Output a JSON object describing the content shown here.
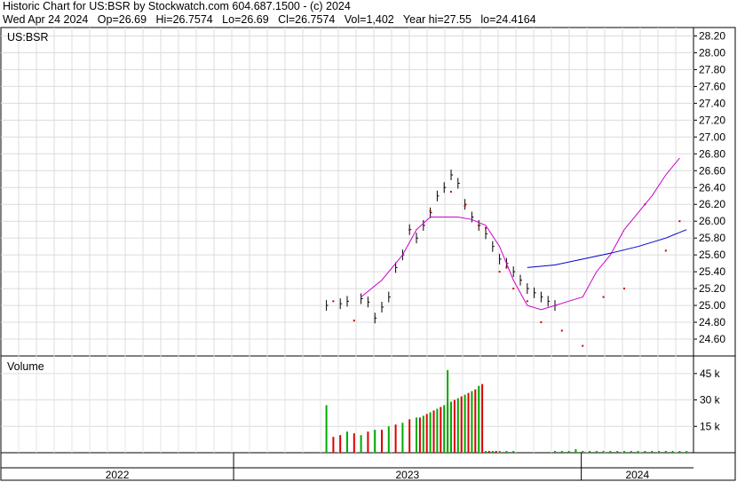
{
  "header": {
    "line1": "Historic Chart for US:BSR by Stockwatch.com 604.687.1500 - (c) 2024",
    "line2": "Wed Apr 24 2024   Op=26.69   Hi=26.7574   Lo=26.69   Cl=26.7574   Vol=1,402   Year hi=27.55   lo=24.4164"
  },
  "chart_data": [
    {
      "type": "line",
      "title": "US:BSR",
      "ylim": [
        24.4,
        28.3
      ],
      "y_ticks": [
        "28.20",
        "28.00",
        "27.80",
        "27.60",
        "27.40",
        "27.20",
        "27.00",
        "26.80",
        "26.60",
        "26.40",
        "26.20",
        "26.00",
        "25.80",
        "25.60",
        "25.40",
        "25.20",
        "25.00",
        "24.80",
        "24.60"
      ],
      "x_ticks": [
        "2022",
        "2023",
        "2024"
      ],
      "x_period_fractions": [
        0,
        0.336,
        0.838,
        1.0
      ],
      "grid": true,
      "series": [
        {
          "color": "#000000",
          "style": "hlc-bars",
          "x": [
            0.47,
            0.49,
            0.5,
            0.52,
            0.53,
            0.54,
            0.55,
            0.56,
            0.57,
            0.58,
            0.59,
            0.6,
            0.61,
            0.62,
            0.63,
            0.64,
            0.65,
            0.66,
            0.67,
            0.68,
            0.69,
            0.7,
            0.71,
            0.72,
            0.73,
            0.74,
            0.75,
            0.76,
            0.77,
            0.78,
            0.79,
            0.8
          ],
          "values": [
            25.0,
            25.02,
            25.05,
            25.08,
            25.04,
            24.85,
            24.98,
            25.1,
            25.45,
            25.6,
            25.9,
            25.8,
            25.95,
            26.1,
            26.3,
            26.4,
            26.55,
            26.45,
            26.2,
            26.05,
            25.95,
            25.85,
            25.7,
            25.55,
            25.5,
            25.4,
            25.3,
            25.2,
            25.15,
            25.1,
            25.05,
            25.0
          ]
        },
        {
          "color": "#cc0000",
          "style": "close-dots",
          "x": [
            0.48,
            0.51,
            0.59,
            0.62,
            0.65,
            0.67,
            0.69,
            0.7,
            0.72,
            0.73,
            0.74,
            0.76,
            0.78,
            0.81,
            0.84,
            0.87,
            0.9,
            0.93,
            0.96,
            0.98
          ],
          "values": [
            25.05,
            24.82,
            25.9,
            26.12,
            26.35,
            26.18,
            25.95,
            25.92,
            25.4,
            25.45,
            25.2,
            25.05,
            24.8,
            24.7,
            24.52,
            25.1,
            25.2,
            26.2,
            25.65,
            26.0
          ]
        },
        {
          "color": "#cc00cc",
          "style": "moving-average",
          "x": [
            0.52,
            0.55,
            0.58,
            0.6,
            0.62,
            0.64,
            0.66,
            0.68,
            0.7,
            0.72,
            0.74,
            0.76,
            0.78,
            0.8,
            0.82,
            0.84,
            0.86,
            0.88,
            0.9,
            0.92,
            0.94,
            0.96,
            0.98
          ],
          "values": [
            25.1,
            25.3,
            25.6,
            25.9,
            26.05,
            26.05,
            26.05,
            26.02,
            25.95,
            25.7,
            25.3,
            25.0,
            24.95,
            25.0,
            25.05,
            25.1,
            25.4,
            25.6,
            25.9,
            26.1,
            26.3,
            26.55,
            26.75
          ]
        },
        {
          "color": "#0000cc",
          "style": "moving-average",
          "x": [
            0.76,
            0.8,
            0.84,
            0.88,
            0.92,
            0.96,
            0.99
          ],
          "values": [
            25.45,
            25.48,
            25.55,
            25.62,
            25.7,
            25.8,
            25.9
          ]
        }
      ]
    },
    {
      "type": "bar",
      "title": "Volume",
      "ylim": [
        0,
        55000
      ],
      "y_ticks": [
        "45 k",
        "30 k",
        "15 k"
      ],
      "series": [
        {
          "color": "#00aa00",
          "style": "bars",
          "x": [
            0.47,
            0.5,
            0.52,
            0.54,
            0.56,
            0.58,
            0.6,
            0.61,
            0.62,
            0.63,
            0.64,
            0.65,
            0.66,
            0.67,
            0.68,
            0.69,
            0.7,
            0.71,
            0.72,
            0.73,
            0.74,
            0.8,
            0.81,
            0.82,
            0.83,
            0.84,
            0.85,
            0.86,
            0.87,
            0.88,
            0.89,
            0.9,
            0.91,
            0.92,
            0.93,
            0.94,
            0.95,
            0.96,
            0.97,
            0.98,
            0.99
          ],
          "values": [
            27000,
            12000,
            10000,
            13000,
            15000,
            17000,
            20000,
            21000,
            23000,
            25000,
            27000,
            29000,
            31000,
            33000,
            35000,
            38000,
            1000,
            1000,
            1000,
            1000,
            1000,
            1000,
            1000,
            1000,
            2000,
            1000,
            1000,
            1000,
            1000,
            1000,
            1000,
            1000,
            1000,
            1000,
            1000,
            1000,
            1000,
            1000,
            1000,
            1000,
            1000
          ]
        },
        {
          "color": "#dd0000",
          "style": "bars",
          "x": [
            0.48,
            0.49,
            0.51,
            0.53,
            0.55,
            0.57,
            0.59,
            0.605,
            0.615,
            0.625,
            0.635,
            0.645,
            0.655,
            0.665,
            0.675,
            0.685,
            0.695,
            0.705,
            0.715
          ],
          "values": [
            9000,
            10000,
            11000,
            12000,
            13000,
            16000,
            19000,
            20000,
            22000,
            24000,
            26000,
            28000,
            30000,
            32000,
            34000,
            36000,
            39000,
            1000,
            1000
          ]
        },
        {
          "color": "#00aa00",
          "style": "bars",
          "x": [
            0.645
          ],
          "values": [
            47000
          ]
        }
      ]
    }
  ]
}
